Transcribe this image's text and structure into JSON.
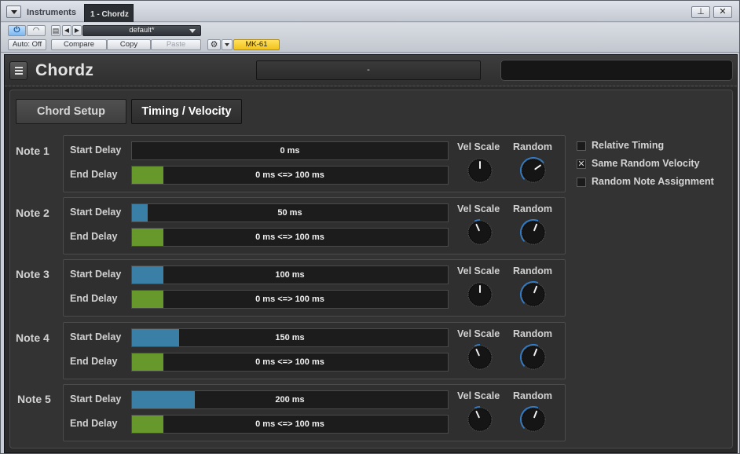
{
  "host": {
    "tabs": [
      {
        "label": "Instruments"
      },
      {
        "label": "1 - Chordz"
      }
    ],
    "window_buttons": {
      "pin": "⊥",
      "close": "✕"
    },
    "toolbar": {
      "power_glyph": "⏻",
      "bypass_glyph": "◠",
      "preset": "default*",
      "auto_label": "Auto: Off",
      "compare_label": "Compare",
      "copy_label": "Copy",
      "paste_label": "Paste",
      "gear_glyph": "⚙",
      "device_label": "MK-61"
    }
  },
  "plugin": {
    "title": "Chordz",
    "preset_display": "-",
    "tabs": [
      {
        "label": "Chord Setup",
        "active": false
      },
      {
        "label": "Timing / Velocity",
        "active": true
      }
    ],
    "labels": {
      "start_delay": "Start Delay",
      "end_delay": "End Delay",
      "vel_scale": "Vel Scale",
      "random": "Random"
    },
    "notes": [
      {
        "name": "Note 1",
        "start_delay": "0 ms",
        "start_fraction": 0.0,
        "end_delay": "0 ms <=> 100 ms",
        "end_fraction": 0.1,
        "vel_scale": 0.5,
        "random": 0.7
      },
      {
        "name": "Note 2",
        "start_delay": "50 ms",
        "start_fraction": 0.05,
        "end_delay": "0 ms <=> 100 ms",
        "end_fraction": 0.1,
        "vel_scale": 0.41,
        "random": 0.58
      },
      {
        "name": "Note 3",
        "start_delay": "100 ms",
        "start_fraction": 0.1,
        "end_delay": "0 ms <=> 100 ms",
        "end_fraction": 0.1,
        "vel_scale": 0.5,
        "random": 0.58
      },
      {
        "name": "Note 4",
        "start_delay": "150 ms",
        "start_fraction": 0.15,
        "end_delay": "0 ms <=> 100 ms",
        "end_fraction": 0.1,
        "vel_scale": 0.41,
        "random": 0.58
      },
      {
        "name": "Note 5",
        "start_delay": "200 ms",
        "start_fraction": 0.2,
        "end_delay": "0 ms <=> 100 ms",
        "end_fraction": 0.1,
        "vel_scale": 0.41,
        "random": 0.58
      }
    ],
    "options": [
      {
        "label": "Relative Timing",
        "checked": false
      },
      {
        "label": "Same Random Velocity",
        "checked": true
      },
      {
        "label": "Random Note Assignment",
        "checked": false
      }
    ],
    "colors": {
      "start_fill": "#3a7fa6",
      "end_fill": "#66982b",
      "arc": "#2f7fd0",
      "device_badge": "#f1c21b"
    }
  }
}
